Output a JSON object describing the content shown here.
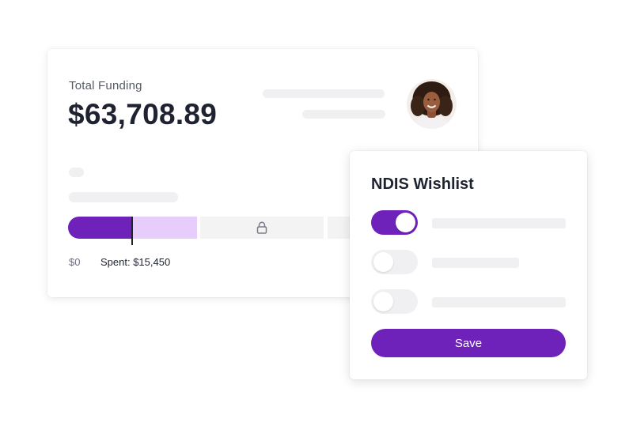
{
  "funding_card": {
    "label": "Total Funding",
    "amount": "$63,708.89",
    "avatar_icon": "user-avatar-photo",
    "progress": {
      "spent_fraction": 0.157,
      "reserved_fraction": 0.156,
      "locked_icon": "lock-icon",
      "scale_start": "$0",
      "spent_label": "Spent: $15,450"
    }
  },
  "wishlist": {
    "title": "NDIS Wishlist",
    "items": [
      {
        "enabled": true
      },
      {
        "enabled": false
      },
      {
        "enabled": false
      }
    ],
    "save_label": "Save"
  },
  "colors": {
    "accent": "#6e22ba",
    "accent_light": "#e7cdfb",
    "skeleton": "#f0f0f2",
    "text_dark": "#1f2331"
  }
}
